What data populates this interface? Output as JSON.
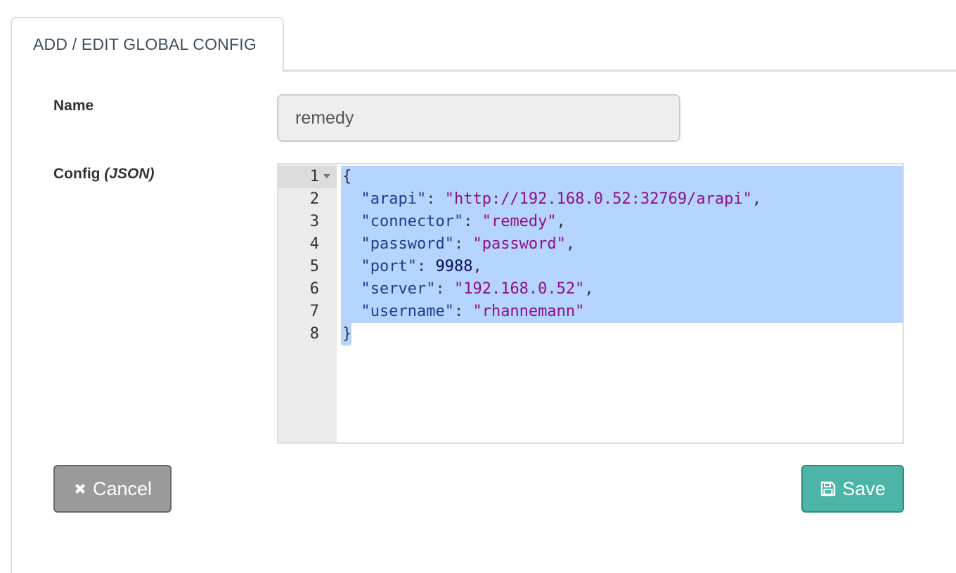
{
  "tab": {
    "label": "ADD / EDIT GLOBAL CONFIG"
  },
  "form": {
    "name_label": "Name",
    "name_value": "remedy",
    "config_label": "Config",
    "config_label_suffix": "(JSON)"
  },
  "editor": {
    "line_numbers": [
      "1",
      "2",
      "3",
      "4",
      "5",
      "6",
      "7",
      "8"
    ],
    "lines": [
      [
        {
          "t": "{",
          "c": "p"
        }
      ],
      [
        {
          "t": "  ",
          "c": "p"
        },
        {
          "t": "\"arapi\"",
          "c": "k"
        },
        {
          "t": ": ",
          "c": "p"
        },
        {
          "t": "\"http://192.168.0.52:32769/arapi\"",
          "c": "s"
        },
        {
          "t": ",",
          "c": "p"
        }
      ],
      [
        {
          "t": "  ",
          "c": "p"
        },
        {
          "t": "\"connector\"",
          "c": "k"
        },
        {
          "t": ": ",
          "c": "p"
        },
        {
          "t": "\"remedy\"",
          "c": "s"
        },
        {
          "t": ",",
          "c": "p"
        }
      ],
      [
        {
          "t": "  ",
          "c": "p"
        },
        {
          "t": "\"password\"",
          "c": "k"
        },
        {
          "t": ": ",
          "c": "p"
        },
        {
          "t": "\"password\"",
          "c": "s"
        },
        {
          "t": ",",
          "c": "p"
        }
      ],
      [
        {
          "t": "  ",
          "c": "p"
        },
        {
          "t": "\"port\"",
          "c": "k"
        },
        {
          "t": ": ",
          "c": "p"
        },
        {
          "t": "9988",
          "c": "n"
        },
        {
          "t": ",",
          "c": "p"
        }
      ],
      [
        {
          "t": "  ",
          "c": "p"
        },
        {
          "t": "\"server\"",
          "c": "k"
        },
        {
          "t": ": ",
          "c": "p"
        },
        {
          "t": "\"192.168.0.52\"",
          "c": "s"
        },
        {
          "t": ",",
          "c": "p"
        }
      ],
      [
        {
          "t": "  ",
          "c": "p"
        },
        {
          "t": "\"username\"",
          "c": "k"
        },
        {
          "t": ": ",
          "c": "p"
        },
        {
          "t": "\"rhannemann\"",
          "c": "s"
        }
      ],
      [
        {
          "t": "}",
          "c": "p"
        }
      ]
    ]
  },
  "buttons": {
    "cancel_label": "Cancel",
    "cancel_icon": "close-icon",
    "save_label": "Save",
    "save_icon": "floppy-disk-icon"
  },
  "colors": {
    "save_button": "#4cb5a7",
    "cancel_button": "#9a9a9a",
    "selection": "#b5d5ff"
  }
}
